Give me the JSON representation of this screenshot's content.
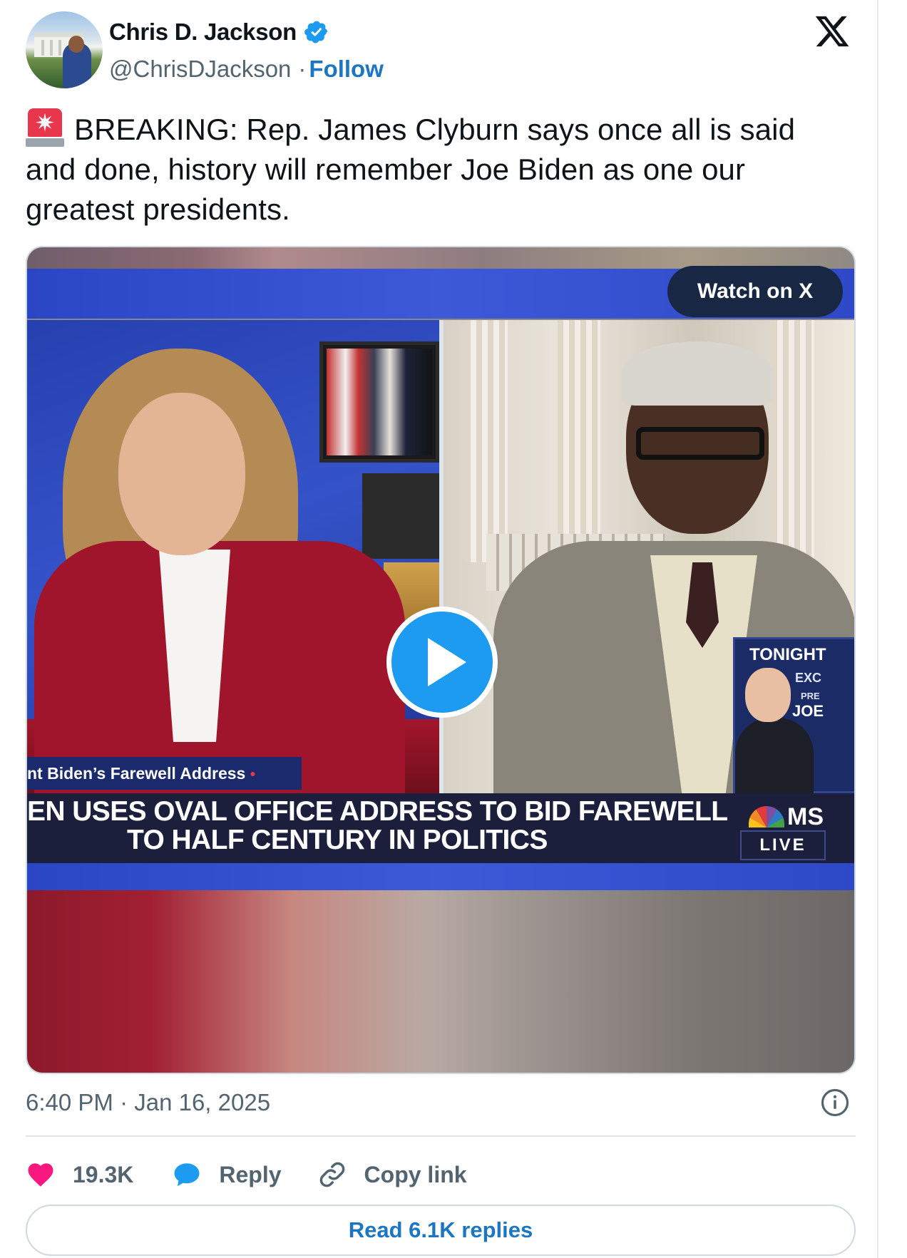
{
  "author": {
    "display_name": "Chris D. Jackson",
    "handle": "@ChrisDJackson",
    "separator": "·",
    "follow_label": "Follow",
    "verified_icon": "verified-badge-icon"
  },
  "tweet": {
    "text": "BREAKING: Rep. James Clyburn says once all is said and done, history will remember Joe Biden as one our greatest presidents.",
    "leading_emoji": "siren-icon"
  },
  "media": {
    "watch_label": "Watch on X",
    "lower_third_left": "nt Biden’s Farewell Address",
    "chyron_line1": "EN USES OVAL OFFICE ADDRESS TO BID FAREWELL",
    "chyron_line2": "TO HALF CENTURY IN POLITICS",
    "network": "MS",
    "live_label": "LIVE",
    "promo_title": "TONIGHT",
    "promo_exc": "EXC",
    "promo_pre": "PRE",
    "promo_joe": "JOE"
  },
  "meta": {
    "timestamp": "6:40 PM · Jan 16, 2025"
  },
  "actions": {
    "likes": "19.3K",
    "reply_label": "Reply",
    "copy_label": "Copy link"
  },
  "replies_button": "Read 6.1K replies",
  "colors": {
    "link_blue": "#1d76c2",
    "play_blue": "#1d9bf0",
    "like_pink": "#f91880",
    "muted_text": "#536471"
  }
}
